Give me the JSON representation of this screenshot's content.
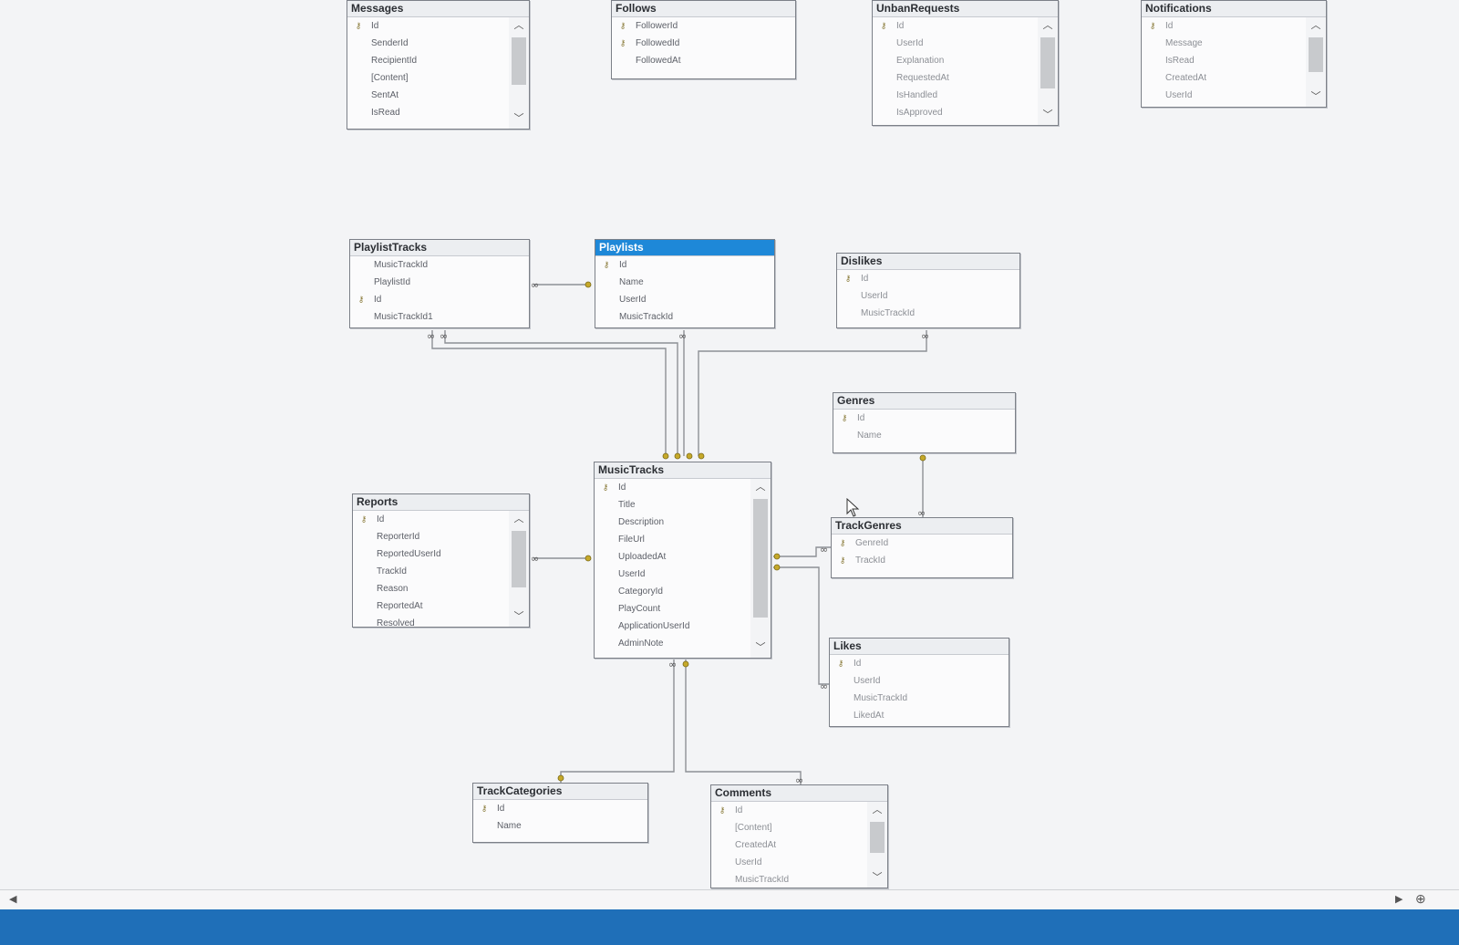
{
  "tables": {
    "messages": {
      "title": "Messages",
      "rows": [
        {
          "name": "Id",
          "key": "⚷"
        },
        {
          "name": "SenderId"
        },
        {
          "name": "RecipientId"
        },
        {
          "name": "[Content]"
        },
        {
          "name": "SentAt"
        },
        {
          "name": "IsRead"
        }
      ]
    },
    "follows": {
      "title": "Follows",
      "rows": [
        {
          "name": "FollowerId",
          "key": "⚷"
        },
        {
          "name": "FollowedId",
          "key": "⚷"
        },
        {
          "name": "FollowedAt"
        }
      ]
    },
    "unbanrequests": {
      "title": "UnbanRequests",
      "rows": [
        {
          "name": "Id",
          "key": "⚷"
        },
        {
          "name": "UserId"
        },
        {
          "name": "Explanation"
        },
        {
          "name": "RequestedAt"
        },
        {
          "name": "IsHandled"
        },
        {
          "name": "IsApproved"
        }
      ]
    },
    "notifications": {
      "title": "Notifications",
      "rows": [
        {
          "name": "Id",
          "key": "⚷"
        },
        {
          "name": "Message"
        },
        {
          "name": "IsRead"
        },
        {
          "name": "CreatedAt"
        },
        {
          "name": "UserId"
        }
      ]
    },
    "playlisttracks": {
      "title": "PlaylistTracks",
      "rows": [
        {
          "name": "MusicTrackId"
        },
        {
          "name": "PlaylistId"
        },
        {
          "name": "Id",
          "key": "⚷"
        },
        {
          "name": "MusicTrackId1"
        }
      ]
    },
    "playlists": {
      "title": "Playlists",
      "rows": [
        {
          "name": "Id",
          "key": "⚷"
        },
        {
          "name": "Name"
        },
        {
          "name": "UserId"
        },
        {
          "name": "MusicTrackId"
        }
      ]
    },
    "dislikes": {
      "title": "Dislikes",
      "rows": [
        {
          "name": "Id",
          "key": "⚷"
        },
        {
          "name": "UserId"
        },
        {
          "name": "MusicTrackId"
        }
      ]
    },
    "genres": {
      "title": "Genres",
      "rows": [
        {
          "name": "Id",
          "key": "⚷"
        },
        {
          "name": "Name"
        }
      ]
    },
    "musictracks": {
      "title": "MusicTracks",
      "rows": [
        {
          "name": "Id",
          "key": "⚷"
        },
        {
          "name": "Title"
        },
        {
          "name": "Description"
        },
        {
          "name": "FileUrl"
        },
        {
          "name": "UploadedAt"
        },
        {
          "name": "UserId"
        },
        {
          "name": "CategoryId"
        },
        {
          "name": "PlayCount"
        },
        {
          "name": "ApplicationUserId"
        },
        {
          "name": "AdminNote"
        }
      ]
    },
    "trackgenres": {
      "title": "TrackGenres",
      "rows": [
        {
          "name": "GenreId",
          "key": "⚷"
        },
        {
          "name": "TrackId",
          "key": "⚷"
        }
      ]
    },
    "reports": {
      "title": "Reports",
      "rows": [
        {
          "name": "Id",
          "key": "⚷"
        },
        {
          "name": "ReporterId"
        },
        {
          "name": "ReportedUserId"
        },
        {
          "name": "TrackId"
        },
        {
          "name": "Reason"
        },
        {
          "name": "ReportedAt"
        },
        {
          "name": "Resolved"
        }
      ]
    },
    "likes": {
      "title": "Likes",
      "rows": [
        {
          "name": "Id",
          "key": "⚷"
        },
        {
          "name": "UserId"
        },
        {
          "name": "MusicTrackId"
        },
        {
          "name": "LikedAt"
        }
      ]
    },
    "trackcategories": {
      "title": "TrackCategories",
      "rows": [
        {
          "name": "Id",
          "key": "⚷"
        },
        {
          "name": "Name"
        }
      ]
    },
    "comments": {
      "title": "Comments",
      "rows": [
        {
          "name": "Id",
          "key": "⚷"
        },
        {
          "name": "[Content]"
        },
        {
          "name": "CreatedAt"
        },
        {
          "name": "UserId"
        },
        {
          "name": "MusicTrackId"
        }
      ]
    }
  },
  "selected_table": "playlists",
  "colors": {
    "selected_title": "#1e88d8",
    "relationship_line": "#8d9096",
    "key_end": "#c6a92a",
    "taskbar": "#1f6fb8"
  },
  "icons": {
    "primary_key": "key-icon",
    "scroll_up": "chevron-up-icon",
    "scroll_down": "chevron-down-icon",
    "cursor": "mouse-pointer-icon"
  }
}
